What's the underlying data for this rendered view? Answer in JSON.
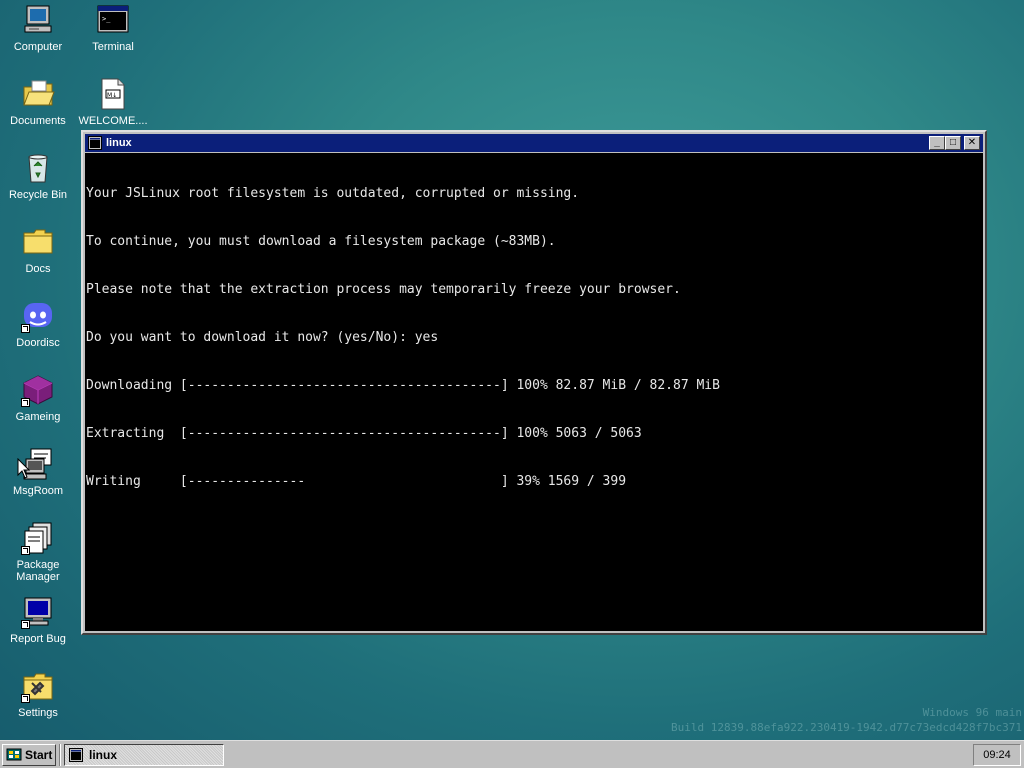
{
  "desktop": {
    "icons": [
      {
        "label": "Computer",
        "icon": "computer-icon"
      },
      {
        "label": "Terminal",
        "icon": "terminal-icon"
      },
      {
        "label": "Documents",
        "icon": "folder-open-icon"
      },
      {
        "label": "WELCOME....",
        "icon": "markdown-file-icon"
      },
      {
        "label": "Recycle Bin",
        "icon": "recycle-bin-icon"
      },
      {
        "label": "Docs",
        "icon": "folder-icon"
      },
      {
        "label": "Doordisc",
        "icon": "discord-icon"
      },
      {
        "label": "Gameing",
        "icon": "game-cube-icon"
      },
      {
        "label": "MsgRoom",
        "icon": "chat-computer-icon"
      },
      {
        "label": "Package Manager",
        "icon": "package-icon"
      },
      {
        "label": "Report Bug",
        "icon": "monitor-icon"
      },
      {
        "label": "Settings",
        "icon": "settings-folder-icon"
      }
    ],
    "watermark": {
      "line1": "Windows 96 main",
      "line2": "Build 12839.88efa922.230419-1942.d77c73edcd428f7bc371"
    }
  },
  "window": {
    "title": "linux",
    "buttons": {
      "minimize": "_",
      "maximize": "□",
      "close": "✕"
    },
    "terminal_lines": [
      "Your JSLinux root filesystem is outdated, corrupted or missing.",
      "To continue, you must download a filesystem package (~83MB).",
      "Please note that the extraction process may temporarily freeze your browser.",
      "Do you want to download it now? (yes/No): yes",
      "Downloading [----------------------------------------] 100% 82.87 MiB / 82.87 MiB",
      "Extracting  [----------------------------------------] 100% 5063 / 5063",
      "Writing     [---------------                         ] 39% 1569 / 399"
    ]
  },
  "taskbar": {
    "start_label": "Start",
    "task_label": "linux",
    "clock": "09:24"
  },
  "colors": {
    "desktop_bg": "#2f8888",
    "titlebar": "#0b1f7a",
    "terminal_bg": "#000000",
    "terminal_fg": "#e8e8e8",
    "chrome": "#c0c0c0"
  }
}
